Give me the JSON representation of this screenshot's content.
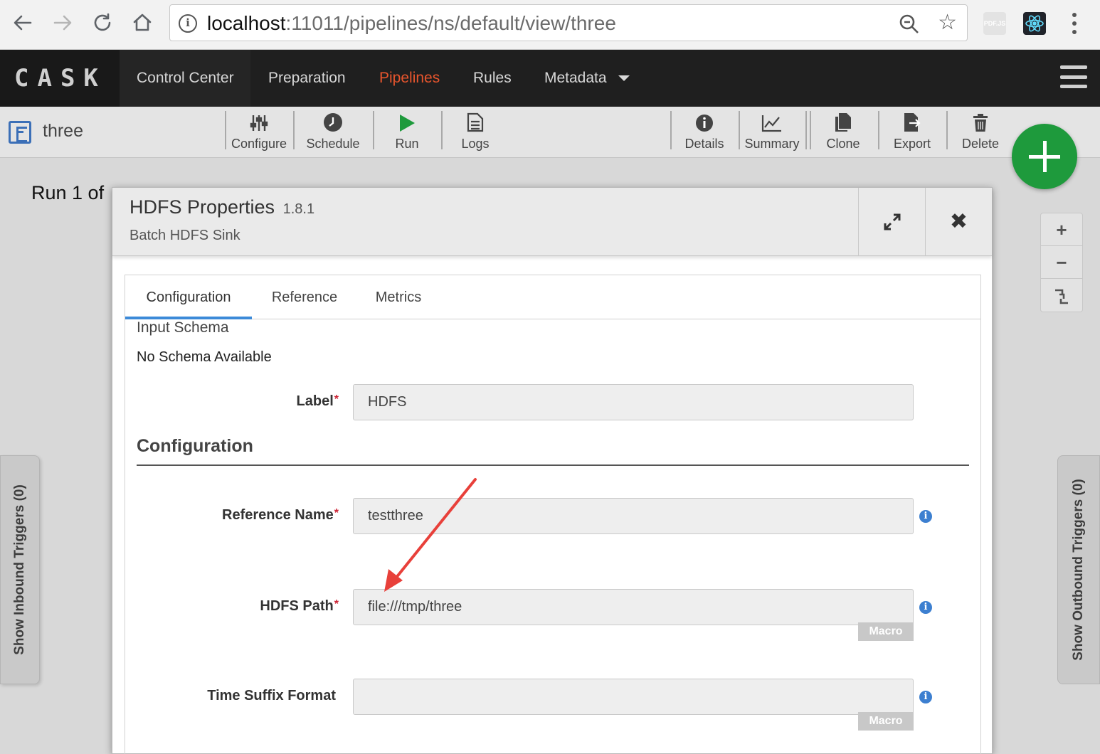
{
  "browser": {
    "url_host": "localhost",
    "url_rest": ":11011/pipelines/ns/default/view/three",
    "ext_pdf_label": "PDF.JS"
  },
  "navbar": {
    "logo": "CASK",
    "items": [
      "Control Center",
      "Preparation",
      "Pipelines",
      "Rules",
      "Metadata"
    ],
    "active": "Pipelines"
  },
  "toolbar": {
    "pipeline_name": "three",
    "left_buttons": [
      "Configure",
      "Schedule",
      "Run",
      "Logs"
    ],
    "right_buttons": [
      "Details",
      "Summary",
      "Clone",
      "Export",
      "Delete"
    ]
  },
  "run_status": "Run 1 of",
  "zoom_controls": [
    "+",
    "−"
  ],
  "side_tabs": {
    "inbound": "Show Inbound Triggers (0)",
    "outbound": "Show Outbound Triggers (0)"
  },
  "modal": {
    "title": "HDFS Properties",
    "version": "1.8.1",
    "subtitle": "Batch HDFS Sink",
    "close_glyph": "✖",
    "tabs": [
      "Configuration",
      "Reference",
      "Metrics"
    ],
    "active_tab": "Configuration",
    "input_schema_title": "Input Schema",
    "input_schema_value": "No Schema Available",
    "section_title": "Configuration",
    "required_mark": "*",
    "macro_label": "Macro",
    "fields": {
      "label": {
        "label": "Label",
        "value": "HDFS"
      },
      "reference_name": {
        "label": "Reference Name",
        "value": "testthree"
      },
      "hdfs_path": {
        "label": "HDFS Path",
        "value": "file:///tmp/three"
      },
      "time_suffix": {
        "label": "Time Suffix Format",
        "value": ""
      }
    }
  },
  "colors": {
    "accent_active_nav": "#e8552d",
    "fab_green": "#1e9a3c",
    "tab_underline": "#3c8ad8",
    "annotation_arrow": "#e8403a"
  }
}
